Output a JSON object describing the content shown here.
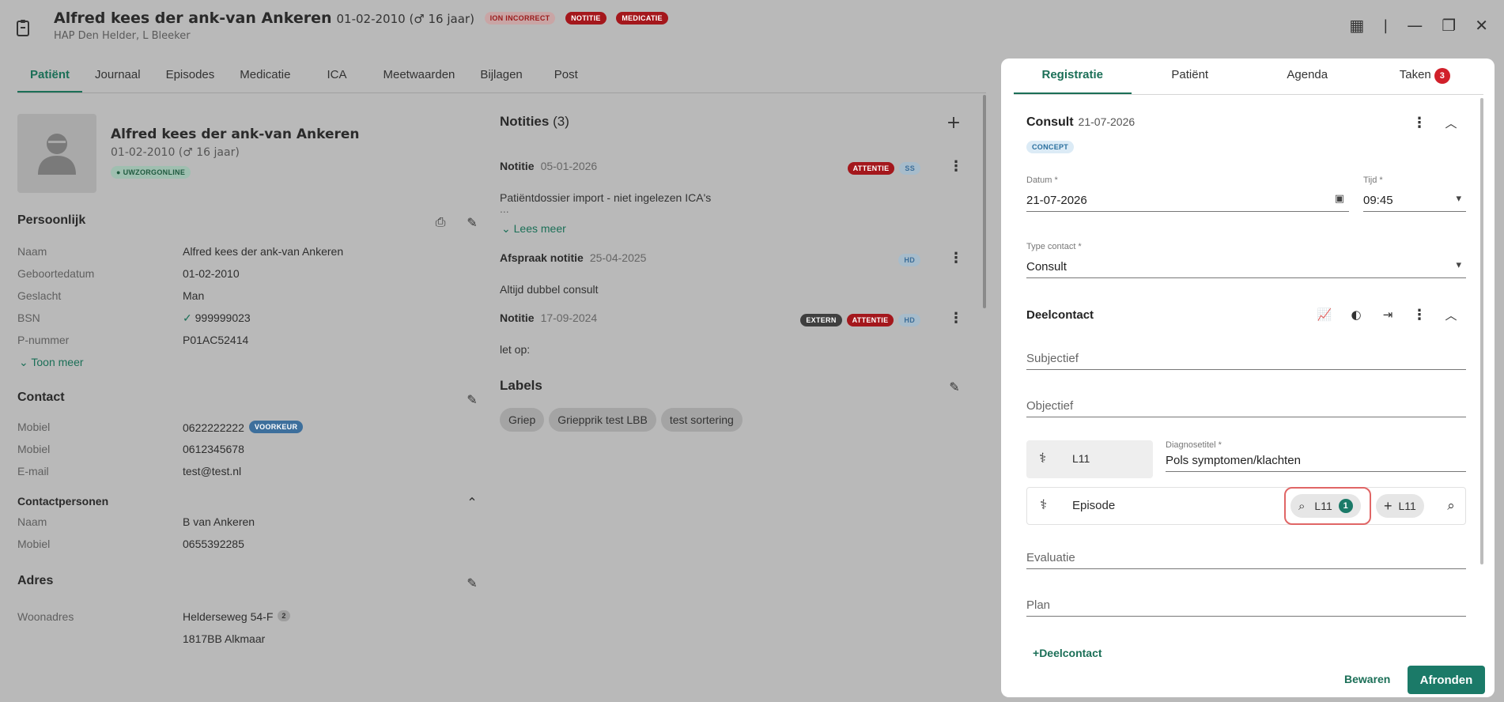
{
  "header": {
    "patient_name": "Alfred kees der ank-van Ankeren",
    "dob_age": "01-02-2010 (♂ 16 jaar)",
    "subtitle": "HAP Den Helder, L Bleeker",
    "badges": [
      "ION INCORRECT",
      "NOTITIE",
      "MEDICATIE"
    ]
  },
  "tabs": [
    "Patiënt",
    "Journaal",
    "Episodes",
    "Medicatie",
    "ICA",
    "Meetwaarden",
    "Bijlagen",
    "Post"
  ],
  "patient_card": {
    "name": "Alfred kees der ank-van Ankeren",
    "dob_age": "01-02-2010 (♂ 16 jaar)",
    "badge": "UWZORGONLINE"
  },
  "persoonlijk": {
    "title": "Persoonlijk",
    "rows": [
      {
        "k": "Naam",
        "v": "Alfred kees der ank-van Ankeren"
      },
      {
        "k": "Geboortedatum",
        "v": "01-02-2010"
      },
      {
        "k": "Geslacht",
        "v": "Man"
      },
      {
        "k": "BSN",
        "v": "999999023"
      },
      {
        "k": "P-nummer",
        "v": "P01AC52414"
      }
    ],
    "toon_meer": "Toon meer"
  },
  "contact": {
    "title": "Contact",
    "rows": [
      {
        "k": "Mobiel",
        "v": "0622222222",
        "badge": "VOORKEUR"
      },
      {
        "k": "Mobiel",
        "v": "0612345678"
      },
      {
        "k": "E-mail",
        "v": "test@test.nl"
      }
    ],
    "contactpersonen_title": "Contactpersonen",
    "contactpersonen": [
      {
        "k": "Naam",
        "v": "B van Ankeren"
      },
      {
        "k": "Mobiel",
        "v": "0655392285"
      }
    ]
  },
  "adres": {
    "title": "Adres",
    "label": "Woonadres",
    "line1": "Helderseweg 54-F",
    "line1_badge": "2",
    "line2": "1817BB Alkmaar"
  },
  "notities": {
    "title": "Notities",
    "count": "(3)",
    "items": [
      {
        "type": "Notitie",
        "date": "05-01-2026",
        "badges": [
          "ATTENTIE",
          "SS"
        ],
        "body": "Patiëntdossier import - niet ingelezen ICA's",
        "more": "..."
      },
      {
        "type": "Afspraak notitie",
        "date": "25-04-2025",
        "badges": [
          "HD"
        ],
        "body": "Altijd dubbel consult"
      },
      {
        "type": "Notitie",
        "date": "17-09-2024",
        "badges": [
          "EXTERN",
          "ATTENTIE",
          "HD"
        ],
        "body": "let op:"
      }
    ],
    "lees_meer": "Lees meer"
  },
  "labels": {
    "title": "Labels",
    "items": [
      "Griep",
      "Griepprik test LBB",
      "test sortering"
    ]
  },
  "panel": {
    "tabs": [
      "Registratie",
      "Patiënt",
      "Agenda",
      "Taken"
    ],
    "taken_count": "3",
    "consult_title": "Consult",
    "consult_date": "21-07-2026",
    "status": "CONCEPT",
    "datum_label": "Datum *",
    "datum_value": "21-07-2026",
    "tijd_label": "Tijd *",
    "tijd_value": "09:45",
    "type_label": "Type contact *",
    "type_value": "Consult",
    "deelcontact_title": "Deelcontact",
    "subjectief": "Subjectief",
    "objectief": "Objectief",
    "code": "L11",
    "diagnose_label": "Diagnosetitel *",
    "diagnose_value": "Pols symptomen/klachten",
    "episode_label": "Episode",
    "episode_search_code": "L11",
    "episode_search_count": "1",
    "episode_add_code": "L11",
    "evaluatie": "Evaluatie",
    "plan": "Plan",
    "add_deelcontact": "Deelcontact",
    "bewaren": "Bewaren",
    "afronden": "Afronden"
  },
  "colors": {
    "accent": "#1b7a68",
    "danger": "#a4171c",
    "highlight": "#e06666"
  }
}
